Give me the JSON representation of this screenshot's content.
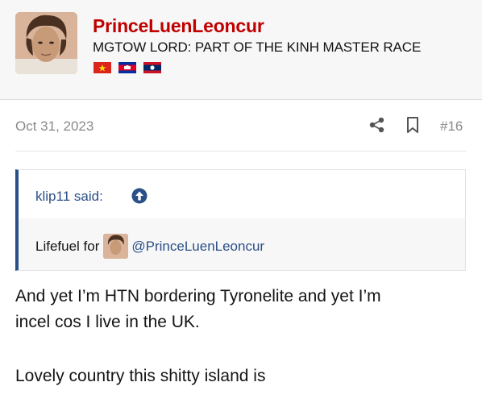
{
  "user": {
    "username": "PrinceLuenLeoncur",
    "title": "MGTOW LORD: PART OF THE KINH MASTER RACE",
    "flags": [
      "vietnam-flag",
      "cambodia-flag",
      "laos-flag"
    ]
  },
  "post": {
    "date": "Oct 31, 2023",
    "number": "#16",
    "icons": [
      "share-icon",
      "bookmark-icon"
    ]
  },
  "quote": {
    "author": "klip11 said:",
    "text_prefix": "Lifefuel for",
    "mention": "@PrinceLuenLeoncur"
  },
  "body": {
    "line1": "And yet I’m HTN bordering Tyronelite and yet I’m",
    "line2": "incel cos I live in the UK.",
    "line3": "Lovely country this shitty island is"
  },
  "colors": {
    "username": "#c00000",
    "link": "#2b4f87",
    "muted": "#8a8a8a"
  }
}
